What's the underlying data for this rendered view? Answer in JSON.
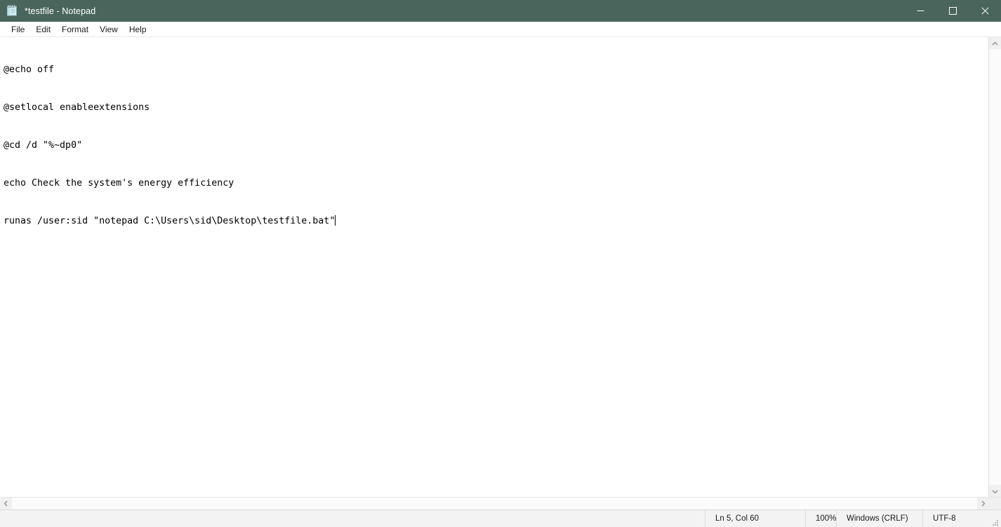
{
  "window": {
    "title": "*testfile - Notepad",
    "icon": "notepad-icon",
    "title_bar_color": "#4a665c",
    "controls": {
      "minimize_label": "Minimize",
      "maximize_label": "Maximize",
      "close_label": "Close"
    }
  },
  "menu": {
    "items": [
      {
        "label": "File"
      },
      {
        "label": "Edit"
      },
      {
        "label": "Format"
      },
      {
        "label": "View"
      },
      {
        "label": "Help"
      }
    ]
  },
  "editor": {
    "lines": [
      "@echo off",
      "@setlocal enableextensions",
      "@cd /d \"%~dp0\"",
      "echo Check the system's energy efficiency",
      "runas /user:sid \"notepad C:\\Users\\sid\\Desktop\\testfile.bat\""
    ]
  },
  "scrollbars": {
    "vertical": {
      "up_arrow": "chevron-up-icon",
      "down_arrow": "chevron-down-icon"
    },
    "horizontal": {
      "left_arrow": "chevron-left-icon",
      "right_arrow": "chevron-right-icon"
    }
  },
  "status_bar": {
    "position": "Ln 5, Col 60",
    "zoom": "100%",
    "line_ending": "Windows (CRLF)",
    "encoding": "UTF-8"
  }
}
